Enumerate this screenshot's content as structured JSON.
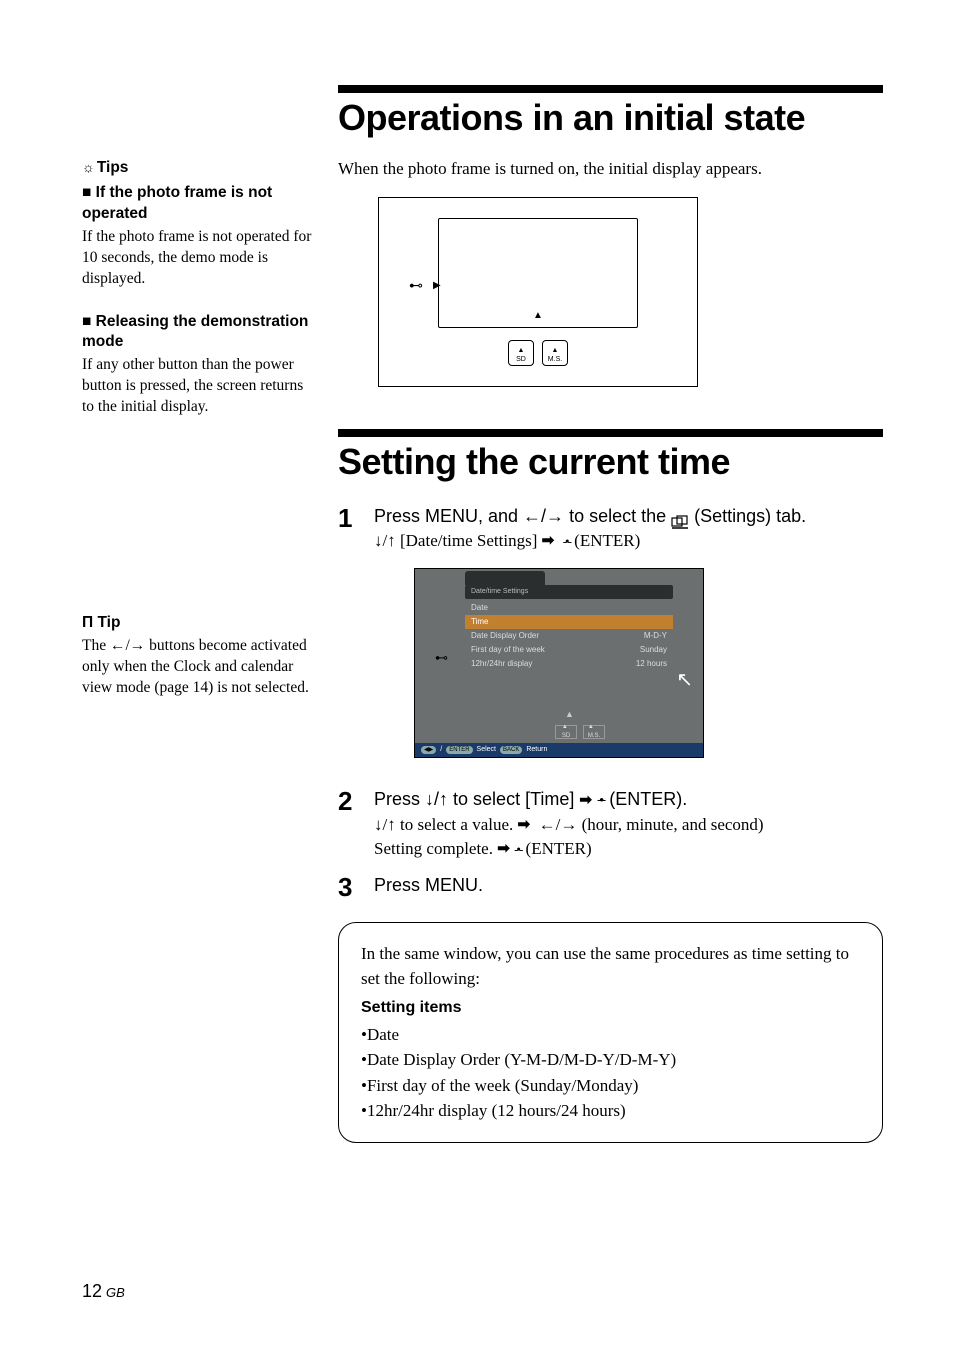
{
  "sidebar": {
    "tips_label": "Tips",
    "block1_hdr_prefix": "■ ",
    "block1_hdr": "If the photo frame is not operated",
    "block1_body": "If the photo frame is not operated for 10 seconds, the demo mode is displayed.",
    "block2_hdr": "Releasing the demonstration mode",
    "block2_body": "If any other button than the power button is pressed, the screen returns to the initial display.",
    "tip_label": "Tip",
    "tip_body_1": "The ",
    "tip_arrows": "B/b",
    "tip_body_2": " buttons become activated only when the Clock and calendar view mode (page 14) is not selected."
  },
  "main": {
    "h1a": "Operations in an initial state",
    "intro": "When the photo frame is turned on, the initial display appears.",
    "slot_sd": "SD",
    "slot_ms": "M.S.",
    "h1b": "Setting the current time",
    "step1_main_a": "Press MENU, and ",
    "step1_main_b": " to select the ",
    "step1_main_c": " (Settings) tab.",
    "step1_sub_a": " [Date/time Settings] ",
    "step1_sub_b": " (ENTER)",
    "screenshot": {
      "title": "Date/time Settings",
      "rows": [
        {
          "l": "Date",
          "r": ""
        },
        {
          "l": "Time",
          "r": ""
        },
        {
          "l": "Date Display Order",
          "r": "M-D-Y"
        },
        {
          "l": "First day of the week",
          "r": "Sunday"
        },
        {
          "l": "12hr/24hr display",
          "r": "12 hours"
        }
      ],
      "footer_select": "Select",
      "footer_return": "Return",
      "footer_enter": "ENTER",
      "footer_back": "BACK"
    },
    "step2_main": "Press v/V to select [Time] ",
    "step2_main_b": " (ENTER).",
    "step2_sub_a": " to select a value. ",
    "step2_sub_b": " (hour, minute, and second)",
    "step2_sub_c": "Setting complete. ",
    "step2_sub_d": " (ENTER)",
    "step3_main": "Press MENU.",
    "box_intro": "In the same window, you can use the same procedures as time setting to set the following:",
    "box_hdr": "Setting items",
    "box_items": [
      "Date",
      "Date Display Order (Y-M-D/M-D-Y/D-M-Y)",
      "First day of the week (Sunday/Monday)",
      "12hr/24hr display (12 hours/24 hours)"
    ]
  },
  "page_number": "12",
  "page_region": "GB"
}
